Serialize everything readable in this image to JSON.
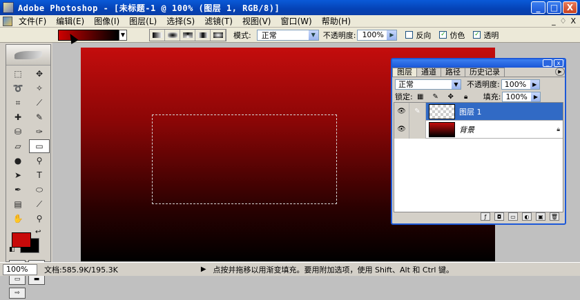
{
  "window": {
    "title": "Adobe Photoshop - [未标题-1 @ 100% (图层 1, RGB/8)]",
    "min_label": "_",
    "max_label": "□",
    "close_label": "X"
  },
  "menu": {
    "items": [
      "文件(F)",
      "编辑(E)",
      "图像(I)",
      "图层(L)",
      "选择(S)",
      "滤镜(T)",
      "视图(V)",
      "窗口(W)",
      "帮助(H)"
    ],
    "doc_min": "_",
    "doc_restore": "♢",
    "doc_close": "X"
  },
  "options": {
    "mode_label": "模式:",
    "mode_value": "正常",
    "opacity_label": "不透明度:",
    "opacity_value": "100%",
    "reverse_label": "反向",
    "reverse_checked": false,
    "dither_label": "仿色",
    "dither_checked": true,
    "transparency_label": "透明",
    "transparency_checked": true,
    "gradient_colors": [
      "#cc0000",
      "#000000"
    ]
  },
  "toolbox": {
    "foreground_color": "#c80a0a",
    "background_color": "#000000"
  },
  "canvas": {
    "gradient_top": "#c40d0d",
    "gradient_bottom": "#000000"
  },
  "layers_panel": {
    "tabs": [
      "图层",
      "通道",
      "路径",
      "历史记录"
    ],
    "blend_mode": "正常",
    "opacity_label": "不透明度:",
    "opacity_value": "100%",
    "lock_label": "锁定:",
    "fill_label": "填充:",
    "fill_value": "100%",
    "layers": [
      {
        "name": "图层 1",
        "selected": true,
        "thumbnail": "transparent"
      },
      {
        "name": "背景",
        "selected": false,
        "thumbnail": "red-gradient",
        "locked": true
      }
    ]
  },
  "status": {
    "zoom": "100%",
    "doc_size": "文档:585.9K/195.3K",
    "hint": "点按并拖移以用渐变填充。要用附加选项，使用 Shift、Alt 和 Ctrl 键。"
  }
}
